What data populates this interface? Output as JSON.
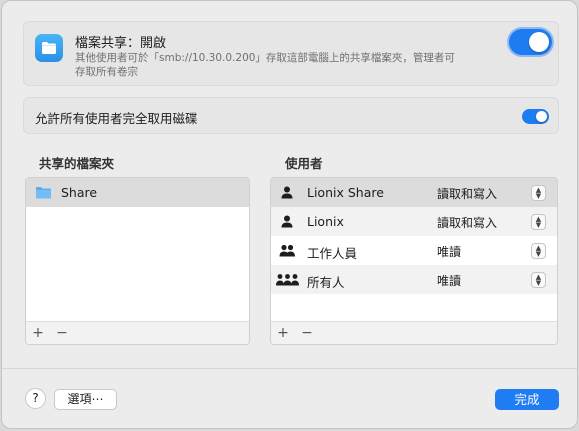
{
  "header": {
    "title": "檔案共享：開啟",
    "description": "其他使用者可於「smb://10.30.0.200」存取這部電腦上的共享檔案夾，管理者可存取所有卷宗",
    "enabled": true
  },
  "allow_all": {
    "label": "允許所有使用者完全取用磁碟",
    "enabled": true
  },
  "shared_folders": {
    "title": "共享的檔案夾",
    "items": [
      {
        "label": "Share",
        "icon": "folder-icon",
        "selected": true
      }
    ],
    "add_label": "+",
    "remove_label": "−"
  },
  "users": {
    "title": "使用者",
    "items": [
      {
        "name": "Lionix Share",
        "permission": "讀取和寫入",
        "icon": "person-icon"
      },
      {
        "name": "Lionix",
        "permission": "讀取和寫入",
        "icon": "person-icon"
      },
      {
        "name": "工作人員",
        "permission": "唯讀",
        "icon": "group-icon"
      },
      {
        "name": "所有人",
        "permission": "唯讀",
        "icon": "everyone-icon"
      }
    ],
    "add_label": "+",
    "remove_label": "−"
  },
  "footer": {
    "help_label": "?",
    "options_label": "選項⋯",
    "done_label": "完成"
  },
  "colors": {
    "accent": "#1e7cf2",
    "sheet_bg": "#ececec"
  }
}
